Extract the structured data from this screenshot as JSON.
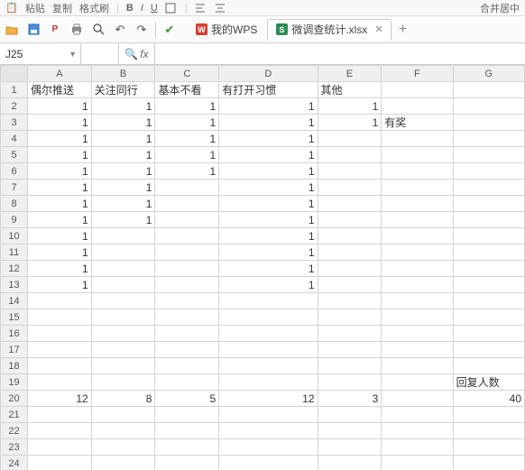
{
  "top_fragments": {
    "paste_label": "粘贴",
    "copy_label": "复制",
    "format_painter": "格式刷",
    "font_bold": "B",
    "font_italic": "I",
    "font_underline": "U",
    "merge_label": "合并居中"
  },
  "toolbar2": {
    "tabs": [
      {
        "label": "我的WPS",
        "icon": "wps-logo-icon"
      },
      {
        "label": "微调查统计.xlsx",
        "icon": "spreadsheet-icon"
      }
    ]
  },
  "formula_bar": {
    "name_box": "J25",
    "fx_label": "fx",
    "formula": ""
  },
  "sheet": {
    "columns": [
      "A",
      "B",
      "C",
      "D",
      "E",
      "F",
      "G"
    ],
    "row_count": 24,
    "headers_row": {
      "A": "偶尔推送",
      "B": "关注同行",
      "C": "基本不看",
      "D": "有打开习惯",
      "E": "其他",
      "F": "",
      "G": ""
    },
    "data": {
      "2": {
        "A": "1",
        "B": "1",
        "C": "1",
        "D": "1",
        "E": "1"
      },
      "3": {
        "A": "1",
        "B": "1",
        "C": "1",
        "D": "1",
        "E": "1",
        "F": "有奖"
      },
      "4": {
        "A": "1",
        "B": "1",
        "C": "1",
        "D": "1"
      },
      "5": {
        "A": "1",
        "B": "1",
        "C": "1",
        "D": "1"
      },
      "6": {
        "A": "1",
        "B": "1",
        "C": "1",
        "D": "1"
      },
      "7": {
        "A": "1",
        "B": "1",
        "D": "1"
      },
      "8": {
        "A": "1",
        "B": "1",
        "D": "1"
      },
      "9": {
        "A": "1",
        "B": "1",
        "D": "1"
      },
      "10": {
        "A": "1",
        "D": "1"
      },
      "11": {
        "A": "1",
        "D": "1"
      },
      "12": {
        "A": "1",
        "D": "1"
      },
      "13": {
        "A": "1",
        "D": "1"
      },
      "19": {
        "G": "回复人数"
      },
      "20": {
        "A": "12",
        "B": "8",
        "C": "5",
        "D": "12",
        "E": "3",
        "G": "40"
      }
    }
  }
}
